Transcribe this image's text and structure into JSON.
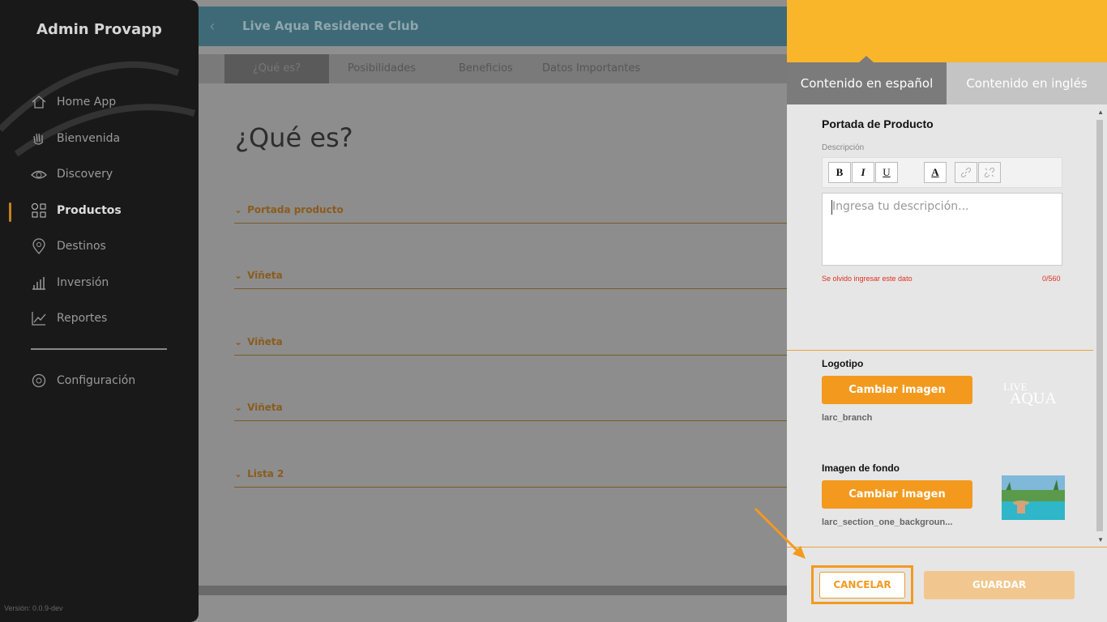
{
  "sidebar": {
    "brand": "Admin Provapp",
    "items": [
      {
        "label": "Home App",
        "icon": "home-icon"
      },
      {
        "label": "Bienvenida",
        "icon": "wave-hand-icon"
      },
      {
        "label": "Discovery",
        "icon": "eye-icon"
      },
      {
        "label": "Productos",
        "icon": "grid-icon",
        "active": true
      },
      {
        "label": "Destinos",
        "icon": "location-pin-icon"
      },
      {
        "label": "Inversión",
        "icon": "bar-chart-icon"
      },
      {
        "label": "Reportes",
        "icon": "line-chart-icon"
      },
      {
        "label": "Configuración",
        "icon": "gear-icon"
      }
    ],
    "version": "Versión: 0.0.9-dev"
  },
  "header": {
    "title": "Live Aqua Residence Club",
    "back_icon": "chevron-left-icon"
  },
  "tabs": [
    "¿Qué es?",
    "Posibilidades",
    "Beneficios",
    "Datos Importantes"
  ],
  "main": {
    "page_title": "¿Qué es?",
    "sections": [
      "Portada producto",
      "Viñeta",
      "Viñeta",
      "Viñeta",
      "Lista 2"
    ]
  },
  "panel": {
    "tab_es": "Contenido en español",
    "tab_en": "Contenido en inglés",
    "cover_title": "Portada de Producto",
    "description_label": "Descripción",
    "toolbar": {
      "bold": "B",
      "italic": "I",
      "underline": "U",
      "color": "A"
    },
    "description_placeholder": "Ingresa tu descripción...",
    "error_text": "Se olvido ingresar este dato",
    "counter": "0/560",
    "logo_title": "Logotipo",
    "change_image": "Cambiar imagen",
    "logo_file": "larc_branch",
    "logo_text_top": "LIVE",
    "logo_text_bottom": "AQUA",
    "bg_title": "Imagen de fondo",
    "bg_file": "larc_section_one_backgroun...",
    "cancel": "CANCELAR",
    "save": "GUARDAR"
  },
  "colors": {
    "accent": "#f39a1e",
    "header_yellow": "#f9b62b",
    "sidebar": "#191919",
    "error": "#e03020"
  }
}
